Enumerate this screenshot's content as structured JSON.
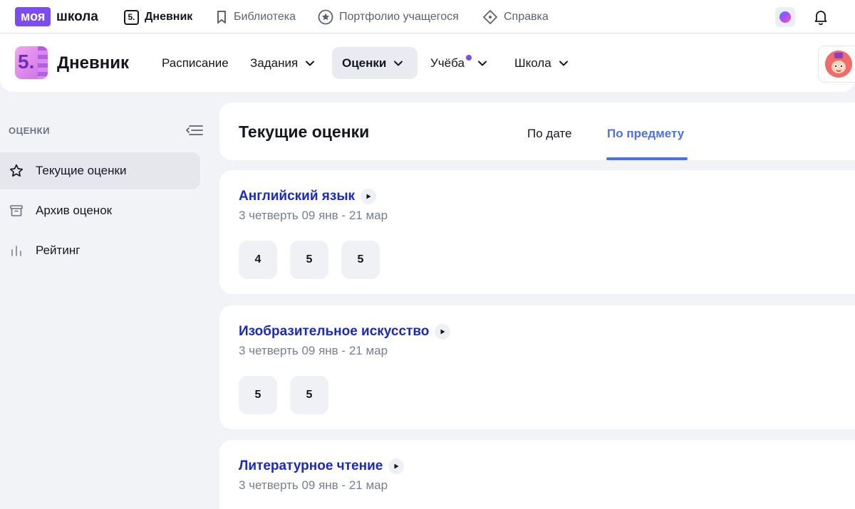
{
  "topbar": {
    "logo_part1": "моя",
    "logo_part2": "школа",
    "nav": [
      {
        "label": "Дневник",
        "icon": "diary-5-icon",
        "active": true
      },
      {
        "label": "Библиотека",
        "icon": "bookmark-icon"
      },
      {
        "label": "Портфолио учащегося",
        "icon": "star-circle-icon"
      },
      {
        "label": "Справка",
        "icon": "diamond-icon"
      }
    ]
  },
  "header": {
    "app_title": "Дневник",
    "logo_digit": "5.",
    "nav": [
      {
        "label": "Расписание",
        "dropdown": false
      },
      {
        "label": "Задания",
        "dropdown": true
      },
      {
        "label": "Оценки",
        "dropdown": true,
        "active": true
      },
      {
        "label": "Учёба",
        "dropdown": true,
        "badge": true
      },
      {
        "label": "Школа",
        "dropdown": true
      }
    ]
  },
  "sidebar": {
    "heading": "ОЦЕНКИ",
    "items": [
      {
        "label": "Текущие оценки",
        "icon": "star-icon",
        "active": true
      },
      {
        "label": "Архив оценок",
        "icon": "archive-icon"
      },
      {
        "label": "Рейтинг",
        "icon": "bar-chart-icon"
      }
    ]
  },
  "main": {
    "title": "Текущие оценки",
    "tabs": [
      {
        "label": "По дате",
        "active": false
      },
      {
        "label": "По предмету",
        "active": true
      }
    ],
    "subjects": [
      {
        "name": "Английский язык",
        "period": "3 четверть 09 янв - 21 мар",
        "marks": [
          "4",
          "5",
          "5"
        ]
      },
      {
        "name": "Изобразительное искусство",
        "period": "3 четверть 09 янв - 21 мар",
        "marks": [
          "5",
          "5"
        ]
      },
      {
        "name": "Литературное чтение",
        "period": "3 четверть 09 янв - 21 мар",
        "marks": []
      }
    ]
  },
  "colors": {
    "accent": "#4c6ef0",
    "subject_link": "#1928c8",
    "brand": "#7b4cf0"
  }
}
